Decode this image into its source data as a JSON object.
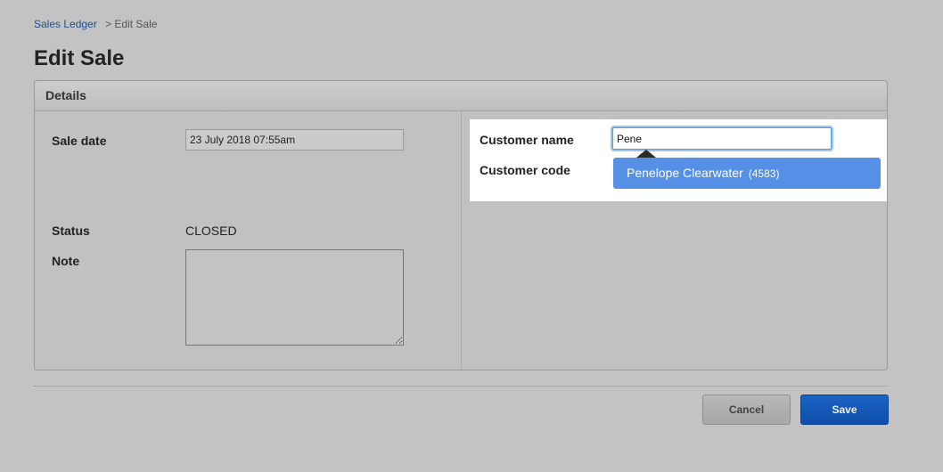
{
  "breadcrumb": {
    "link": "Sales Ledger",
    "current": "> Edit Sale"
  },
  "page_title": "Edit Sale",
  "panel": {
    "header": "Details",
    "left": {
      "sale_date_label": "Sale date",
      "sale_date_value": "23 July 2018 07:55am",
      "status_label": "Status",
      "status_value": "CLOSED",
      "note_label": "Note",
      "note_value": ""
    },
    "right": {
      "customer_name_label": "Customer name",
      "customer_name_value": "Pene",
      "customer_code_label": "Customer code",
      "suggestion": {
        "name": "Penelope Clearwater",
        "code": "(4583)"
      }
    }
  },
  "actions": {
    "cancel_label": "Cancel",
    "save_label": "Save"
  },
  "colors": {
    "background": "#c3c3c3",
    "link": "#1f4f8f",
    "suggestion_bg": "#5590e6",
    "save_button": "#1d63c4",
    "focus_ring": "#9ec5f0"
  },
  "icons": {
    "dropdown_caret": "caret-up-icon"
  }
}
